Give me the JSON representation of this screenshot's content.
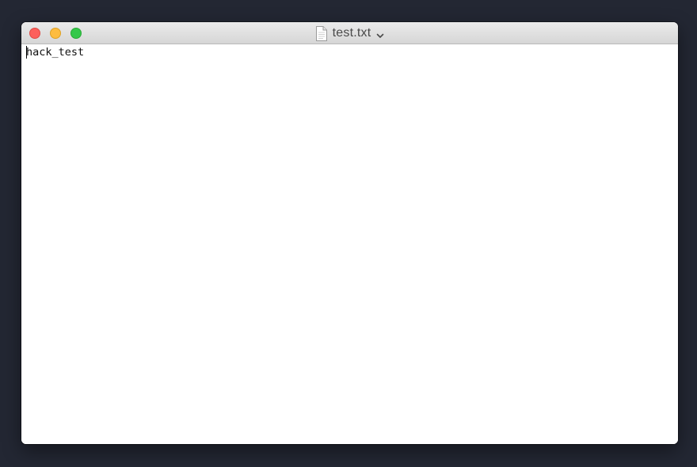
{
  "window": {
    "title": "test.txt",
    "file_icon": "document-icon",
    "title_menu_icon": "chevron-down-icon",
    "controls": {
      "close_color": "#fc605c",
      "minimize_color": "#fdbc40",
      "maximize_color": "#34c84a"
    }
  },
  "editor": {
    "text": "hack_test"
  },
  "colors": {
    "desktop_background": "#232733",
    "editor_background": "#ffffff"
  }
}
